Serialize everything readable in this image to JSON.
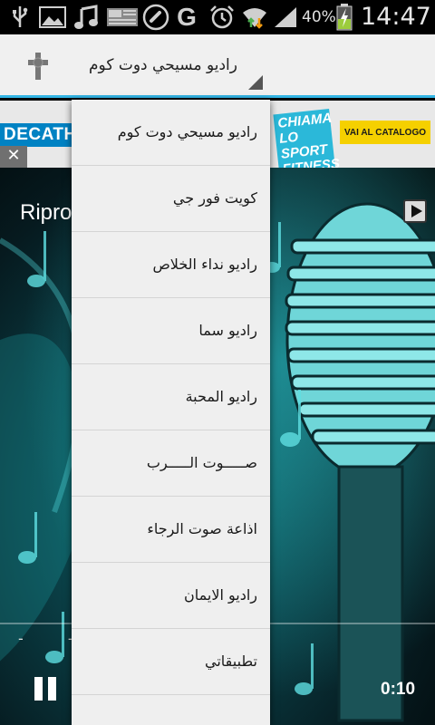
{
  "status_bar": {
    "icons": [
      "usb-icon",
      "image-icon",
      "music-note-icon",
      "news-icon",
      "phone-icon",
      "google-icon",
      "alarm-icon",
      "wifi-icon",
      "signal-icon",
      "battery-charging-icon"
    ],
    "battery": "40%",
    "time": "14:47"
  },
  "action_bar": {
    "logo_icon": "cross-icon",
    "selected_station": "راديو مسيحي دوت كوم"
  },
  "ad": {
    "brand": "DECATHLON",
    "tagline": "CHIAMA LO SPORT FITNESS",
    "cta": "VAI AL CATALOGO",
    "close": "✕"
  },
  "player": {
    "title": "Ripro",
    "elapsed_placeholder": "-  -",
    "time": "0:10"
  },
  "dropdown": {
    "items": [
      "راديو مسيحي دوت كوم",
      "كويت فور جي",
      "راديو نداء الخلاص",
      "راديو سما",
      "راديو المحبة",
      "صـــــوت الـــــرب",
      "اذاعة صوت الرجاء",
      "راديو الايمان",
      "تطبيقاتي"
    ]
  },
  "colors": {
    "accent": "#33b5e5",
    "actionbar_bg": "#f0f0f0",
    "dropdown_bg": "#efefef",
    "player_teal": "#0d6f72"
  }
}
